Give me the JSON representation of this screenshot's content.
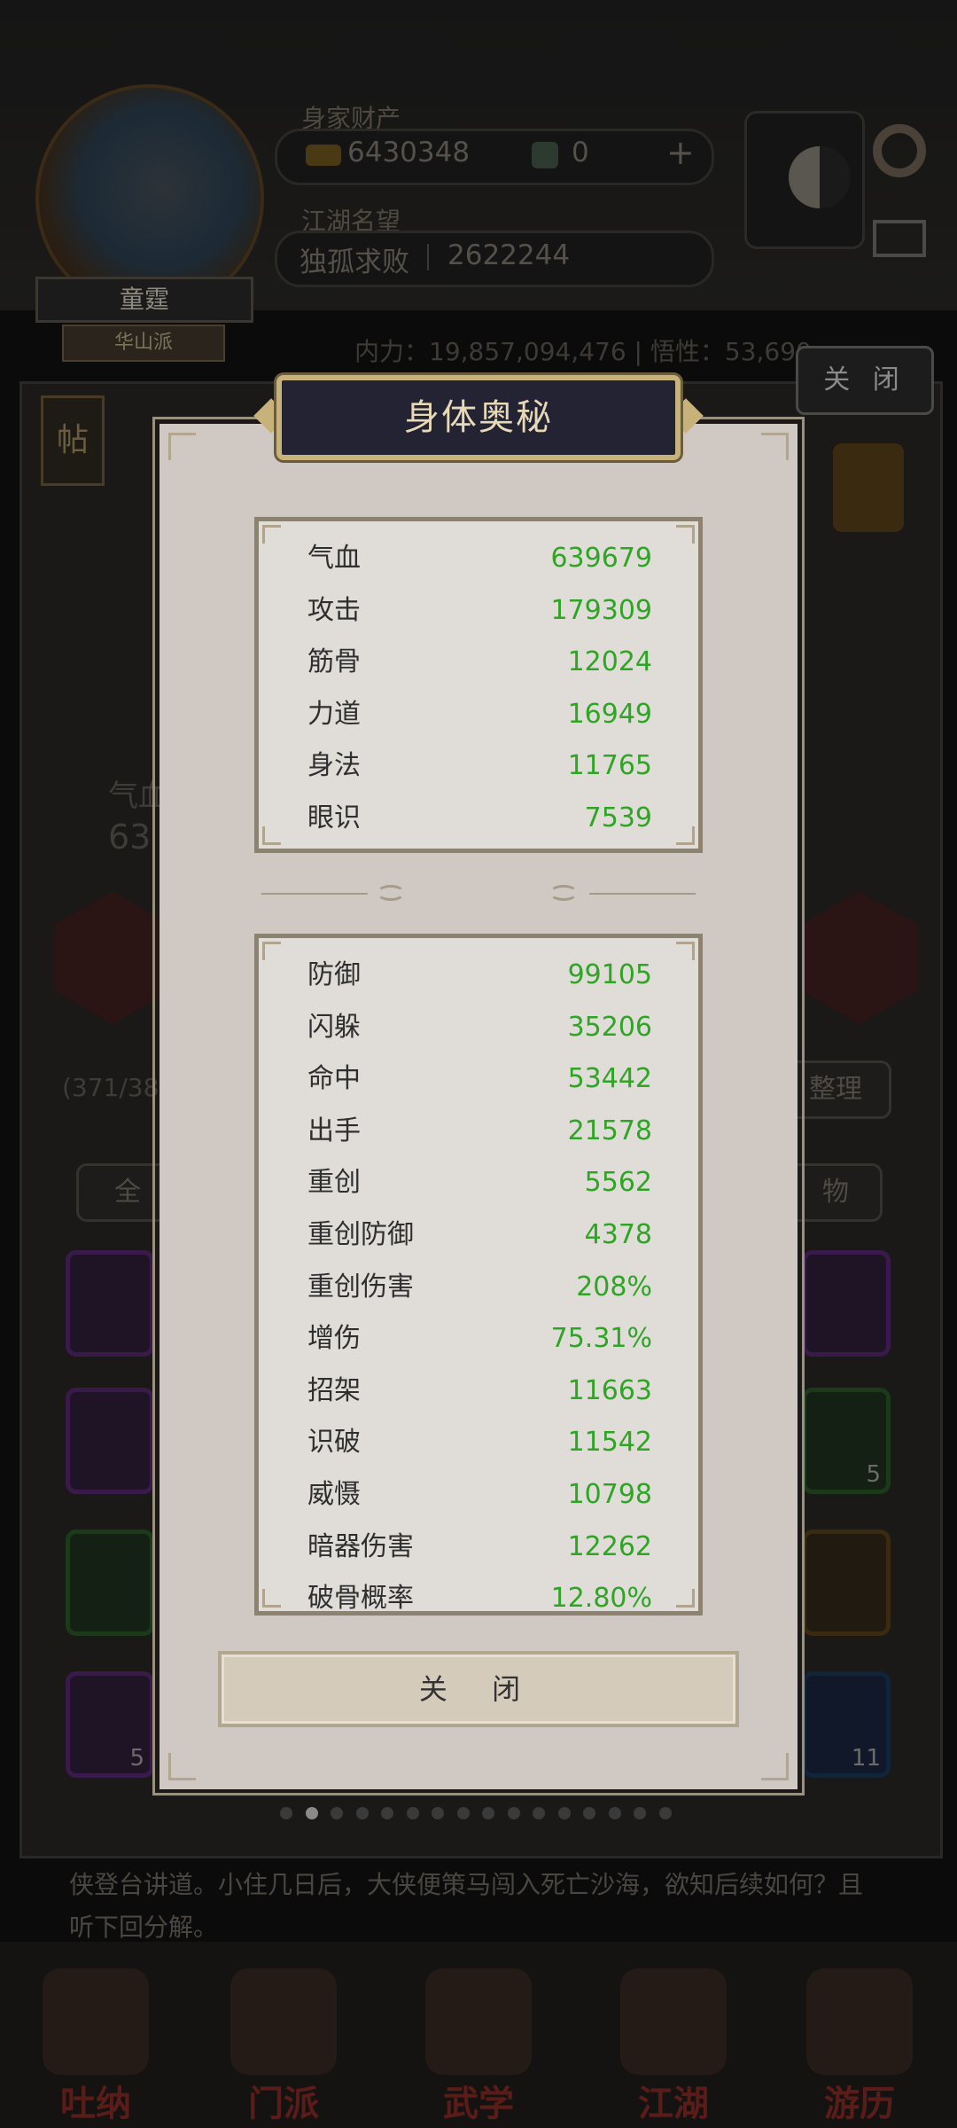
{
  "header": {
    "wealth_label": "身家财产",
    "coins": "6430348",
    "tickets": "0",
    "add_symbol": "+",
    "fame_label": "江湖名望",
    "title_name": "独孤求败",
    "fame_value": "2622244",
    "player_name": "童霆",
    "sect": "华山派"
  },
  "stats_bar": {
    "text": "内力：19,857,094,476  |  悟性：53,690"
  },
  "background_close": "关 闭",
  "background": {
    "tie_label": "帖",
    "qixue_partial": "气血",
    "qixue_value_partial": "63",
    "bag_count_partial": "(371/38",
    "sort_button": "整理",
    "filter_all": "全",
    "filter_items": "物",
    "slot_counts": [
      "5",
      "5",
      "11"
    ],
    "story": "侠登台讲道。小住几日后，大侠便策马闯入死亡沙海，欲知后续如何？且听下回分解。"
  },
  "nav": [
    {
      "label": "吐纳"
    },
    {
      "label": "门派"
    },
    {
      "label": "武学"
    },
    {
      "label": "江湖"
    },
    {
      "label": "游历"
    }
  ],
  "modal": {
    "title": "身体奥秘",
    "basic_stats": [
      {
        "name": "气血",
        "value": "639679"
      },
      {
        "name": "攻击",
        "value": "179309"
      },
      {
        "name": "筋骨",
        "value": "12024"
      },
      {
        "name": "力道",
        "value": "16949"
      },
      {
        "name": "身法",
        "value": "11765"
      },
      {
        "name": "眼识",
        "value": "7539"
      }
    ],
    "advanced_stats": [
      {
        "name": "防御",
        "value": "99105"
      },
      {
        "name": "闪躲",
        "value": "35206"
      },
      {
        "name": "命中",
        "value": "53442"
      },
      {
        "name": "出手",
        "value": "21578"
      },
      {
        "name": "重创",
        "value": "5562"
      },
      {
        "name": "重创防御",
        "value": "4378"
      },
      {
        "name": "重创伤害",
        "value": "208%"
      },
      {
        "name": "增伤",
        "value": "75.31%"
      },
      {
        "name": "招架",
        "value": "11663"
      },
      {
        "name": "识破",
        "value": "11542"
      },
      {
        "name": "威慑",
        "value": "10798"
      },
      {
        "name": "暗器伤害",
        "value": "12262"
      },
      {
        "name": "破骨概率",
        "value": "12.80%"
      }
    ],
    "close_label": "关 闭"
  },
  "pager": {
    "count": 16,
    "active": 1
  },
  "colors": {
    "stat_value": "#2fa525",
    "title_text": "#e7d9b8",
    "modal_bg": "#d0c9c3"
  }
}
